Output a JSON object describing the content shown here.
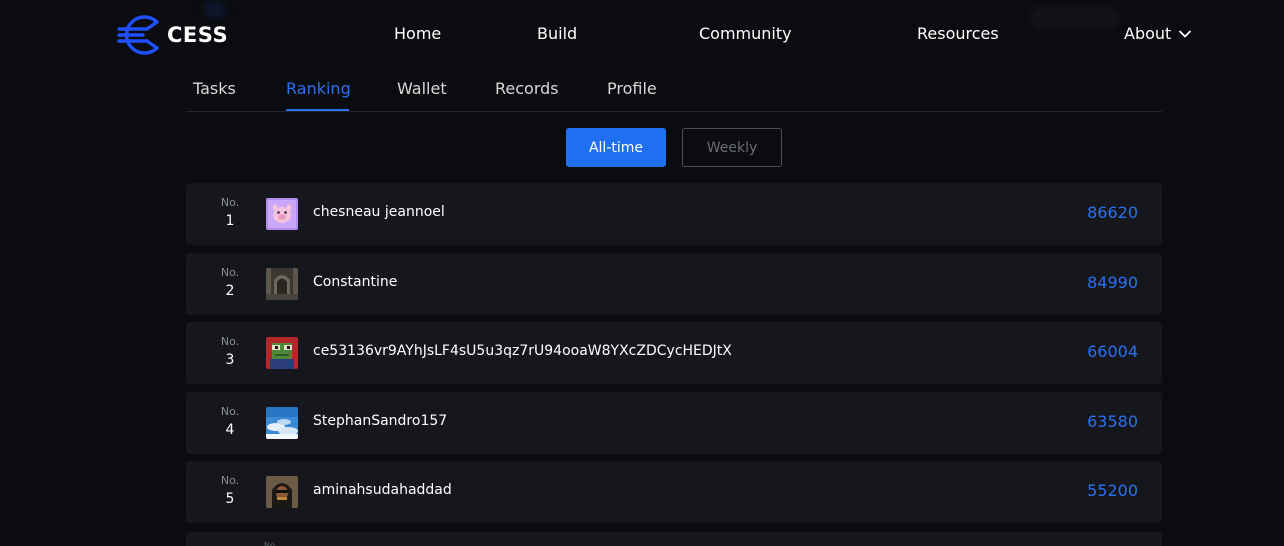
{
  "header": {
    "logo_text": "CESS",
    "brand_color": "#1f4fff",
    "nav": {
      "home": "Home",
      "build": "Build",
      "community": "Community",
      "resources": "Resources",
      "about": "About"
    }
  },
  "tabs": {
    "tasks": "Tasks",
    "ranking": "Ranking",
    "wallet": "Wallet",
    "records": "Records",
    "profile": "Profile",
    "active": "Ranking",
    "active_color": "#2a70f2"
  },
  "filter": {
    "all_time": "All-time",
    "weekly": "Weekly",
    "selected": "All-time"
  },
  "ranking": {
    "no_label": "No.",
    "score_color": "#2a70f2",
    "rows": [
      {
        "rank": "1",
        "name": "chesneau jeannoel",
        "score": "86620",
        "avatar_icon": "pink-cartoon-avatar-icon"
      },
      {
        "rank": "2",
        "name": "Constantine",
        "score": "84990",
        "avatar_icon": "gothic-interior-avatar-icon"
      },
      {
        "rank": "3",
        "name": "ce53136vr9AYhJsLF4sU5u3qz7rU94ooaW8YXcZDCycHEDJtX",
        "score": "66004",
        "avatar_icon": "pixel-frog-avatar-icon"
      },
      {
        "rank": "4",
        "name": "StephanSandro157",
        "score": "63580",
        "avatar_icon": "sky-clouds-avatar-icon"
      },
      {
        "rank": "5",
        "name": "aminahsudahaddad",
        "score": "55200",
        "avatar_icon": "hooded-figure-avatar-icon"
      }
    ]
  }
}
